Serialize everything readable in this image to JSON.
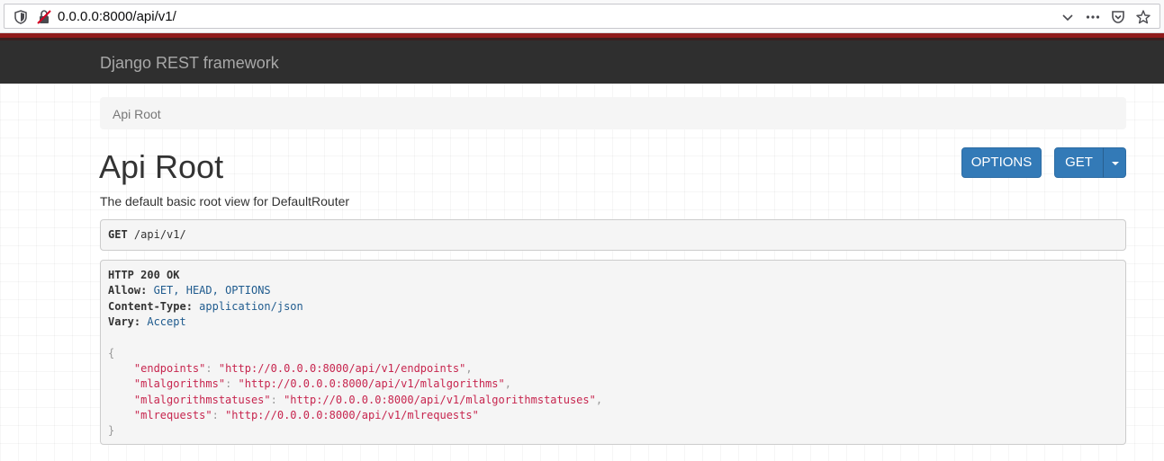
{
  "browser": {
    "url": "0.0.0.0:8000/api/v1/"
  },
  "navbar": {
    "brand": "Django REST framework"
  },
  "breadcrumb": {
    "current": "Api Root"
  },
  "page": {
    "title": "Api Root",
    "description": "The default basic root view for DefaultRouter"
  },
  "actions": {
    "options_label": "OPTIONS",
    "get_label": "GET"
  },
  "request": {
    "method": "GET",
    "path": "/api/v1/"
  },
  "response": {
    "status": "HTTP 200 OK",
    "headers": [
      {
        "name": "Allow:",
        "value": "GET, HEAD, OPTIONS"
      },
      {
        "name": "Content-Type:",
        "value": "application/json"
      },
      {
        "name": "Vary:",
        "value": "Accept"
      }
    ],
    "open_brace": "{",
    "close_brace": "}",
    "body": [
      {
        "key": "\"endpoints\"",
        "value": "\"http://0.0.0.0:8000/api/v1/endpoints\"",
        "sep": ","
      },
      {
        "key": "\"mlalgorithms\"",
        "value": "\"http://0.0.0.0:8000/api/v1/mlalgorithms\"",
        "sep": ","
      },
      {
        "key": "\"mlalgorithmstatuses\"",
        "value": "\"http://0.0.0.0:8000/api/v1/mlalgorithmstatuses\"",
        "sep": ","
      },
      {
        "key": "\"mlrequests\"",
        "value": "\"http://0.0.0.0:8000/api/v1/mlrequests\"",
        "sep": ""
      }
    ]
  },
  "icons": {
    "shield": "shield-icon",
    "insecure": "insecure-connection-icon",
    "chevron": "chevron-down-icon",
    "more": "more-icon",
    "pocket": "pocket-icon",
    "star": "bookmark-star-icon"
  },
  "colors": {
    "navbar": "#2f2f2f",
    "accent": "#8f1b1b",
    "button": "#337ab7",
    "string": "#c7254e",
    "literal": "#1f5b8e"
  }
}
